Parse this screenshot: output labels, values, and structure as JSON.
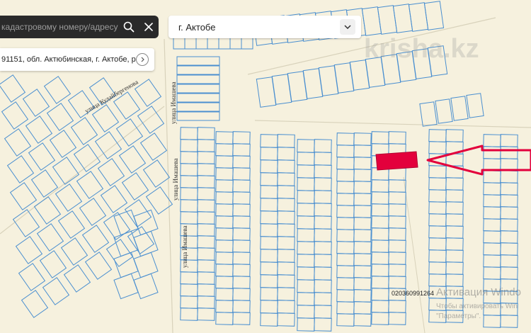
{
  "search": {
    "placeholder": "кадастровому номеру/адресу",
    "search_icon": "search-icon",
    "clear_icon": "close-icon"
  },
  "city": {
    "selected": "г. Актобе",
    "chevron_icon": "chevron-down-icon"
  },
  "result": {
    "text": "91151, обл. Актюбинская, г. Актобе, р-н ...",
    "go_icon": "arrow-right-icon"
  },
  "watermark": "krisha.kz",
  "cadastral_label": "020360991264",
  "streets": {
    "kudaibergenova": "улица Кудайбергенова",
    "imasheva_top": "улица Имашева",
    "imasheva_mid": "улица Имашева",
    "imasheva_bottom": "улица Имашева"
  },
  "windows_notice": {
    "title": "Активация Windo",
    "line1": "Чтобы активировать Win",
    "line2": "\"Параметры\"."
  },
  "colors": {
    "background": "#f6f1de",
    "parcel_stroke": "#4a8fd0",
    "highlight_fill": "#e3003c",
    "arrow_stroke": "#e3003c"
  }
}
